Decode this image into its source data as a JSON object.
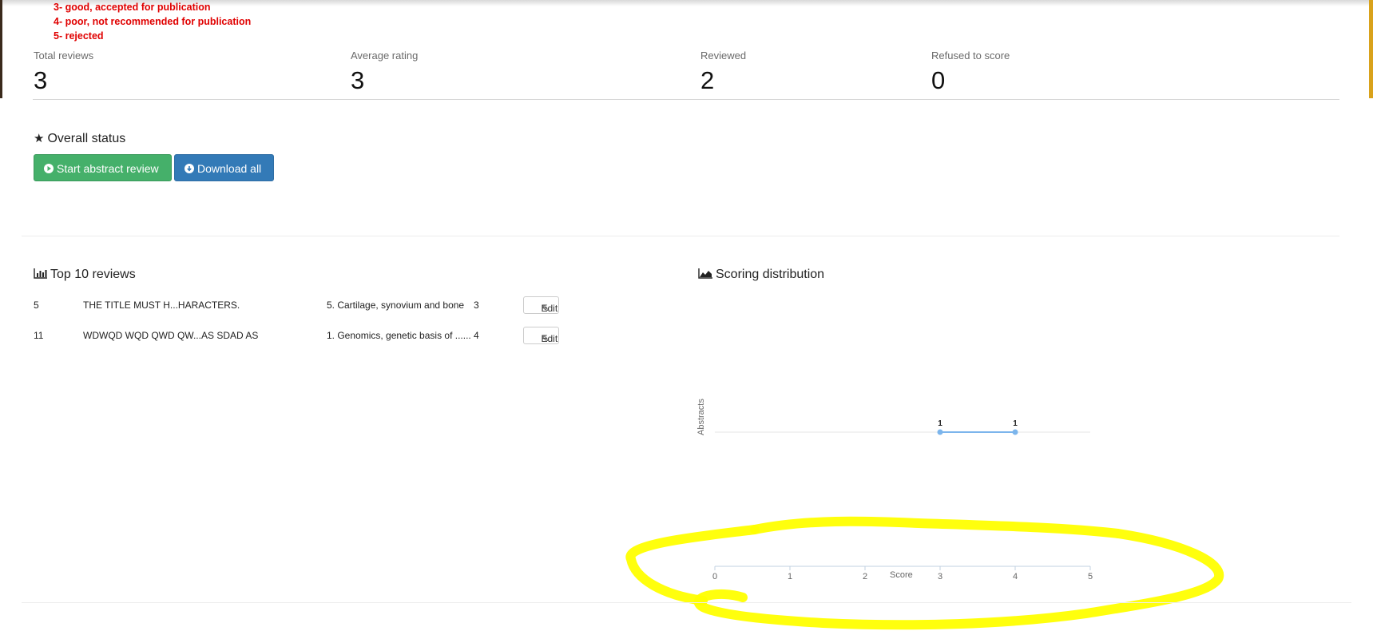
{
  "legend": {
    "items": [
      "3- good, accepted for publication",
      "4- poor, not recommended for publication",
      "5- rejected"
    ]
  },
  "stats": {
    "total_reviews": {
      "label": "Total reviews",
      "value": "3"
    },
    "average_rating": {
      "label": "Average rating",
      "value": "3"
    },
    "reviewed": {
      "label": "Reviewed",
      "value": "2"
    },
    "refused": {
      "label": "Refused to score",
      "value": "0"
    }
  },
  "overall": {
    "title": "Overall status",
    "start_label": "Start abstract review",
    "download_label": "Download all"
  },
  "top_reviews": {
    "title": "Top 10 reviews",
    "edit_label": "Edit",
    "rows": [
      {
        "id": "5",
        "title": "THE TITLE MUST H...HARACTERS.",
        "topic": "5. Cartilage, synovium and bone",
        "score": "3"
      },
      {
        "id": "11",
        "title": "WDWQD WQD QWD QW...AS SDAD AS",
        "topic": "1. Genomics, genetic basis of ......",
        "score": "4"
      }
    ]
  },
  "distribution": {
    "title": "Scoring distribution"
  },
  "chart_data": {
    "type": "line",
    "title": "",
    "xlabel": "Score",
    "ylabel": "Abstracts",
    "xlim": [
      0,
      5
    ],
    "x_ticks": [
      "0",
      "1",
      "2",
      "3",
      "4",
      "5"
    ],
    "series": [
      {
        "x": [
          3,
          4
        ],
        "values": [
          1,
          1
        ],
        "labels": [
          "1",
          "1"
        ],
        "color": "#7cb5ec"
      }
    ]
  },
  "colors": {
    "legend_text": "#e00000",
    "start_button": "#45b06a",
    "download_button": "#337ab7",
    "series_line": "#7cb5ec",
    "highlight": "#ffff00"
  }
}
